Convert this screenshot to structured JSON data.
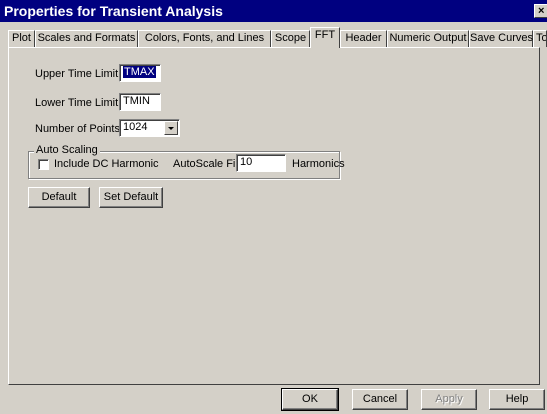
{
  "window": {
    "title": "Properties for Transient Analysis",
    "close_glyph": "×"
  },
  "tabs": [
    {
      "label": "Plot"
    },
    {
      "label": "Scales and Formats"
    },
    {
      "label": "Colors, Fonts, and Lines"
    },
    {
      "label": "Scope"
    },
    {
      "label": "FFT",
      "active": true
    },
    {
      "label": "Header"
    },
    {
      "label": "Numeric Output"
    },
    {
      "label": "Save Curves"
    },
    {
      "label": "Tool Bar"
    }
  ],
  "fft": {
    "upper_time_limit": {
      "label": "Upper Time Limit",
      "value": "TMAX"
    },
    "lower_time_limit": {
      "label": "Lower Time Limit",
      "value": "TMIN"
    },
    "number_of_points": {
      "label": "Number of Points",
      "value": "1024"
    },
    "auto_scaling": {
      "title": "Auto Scaling",
      "include_dc_label": "Include DC Harmonic",
      "include_dc_checked": false,
      "autoscale_first_label": "AutoScale First",
      "autoscale_first_value": "10",
      "harmonics_label": "Harmonics"
    },
    "default_button": "Default",
    "set_default_button": "Set Default"
  },
  "footer": {
    "ok": "OK",
    "cancel": "Cancel",
    "apply": "Apply",
    "help": "Help"
  }
}
